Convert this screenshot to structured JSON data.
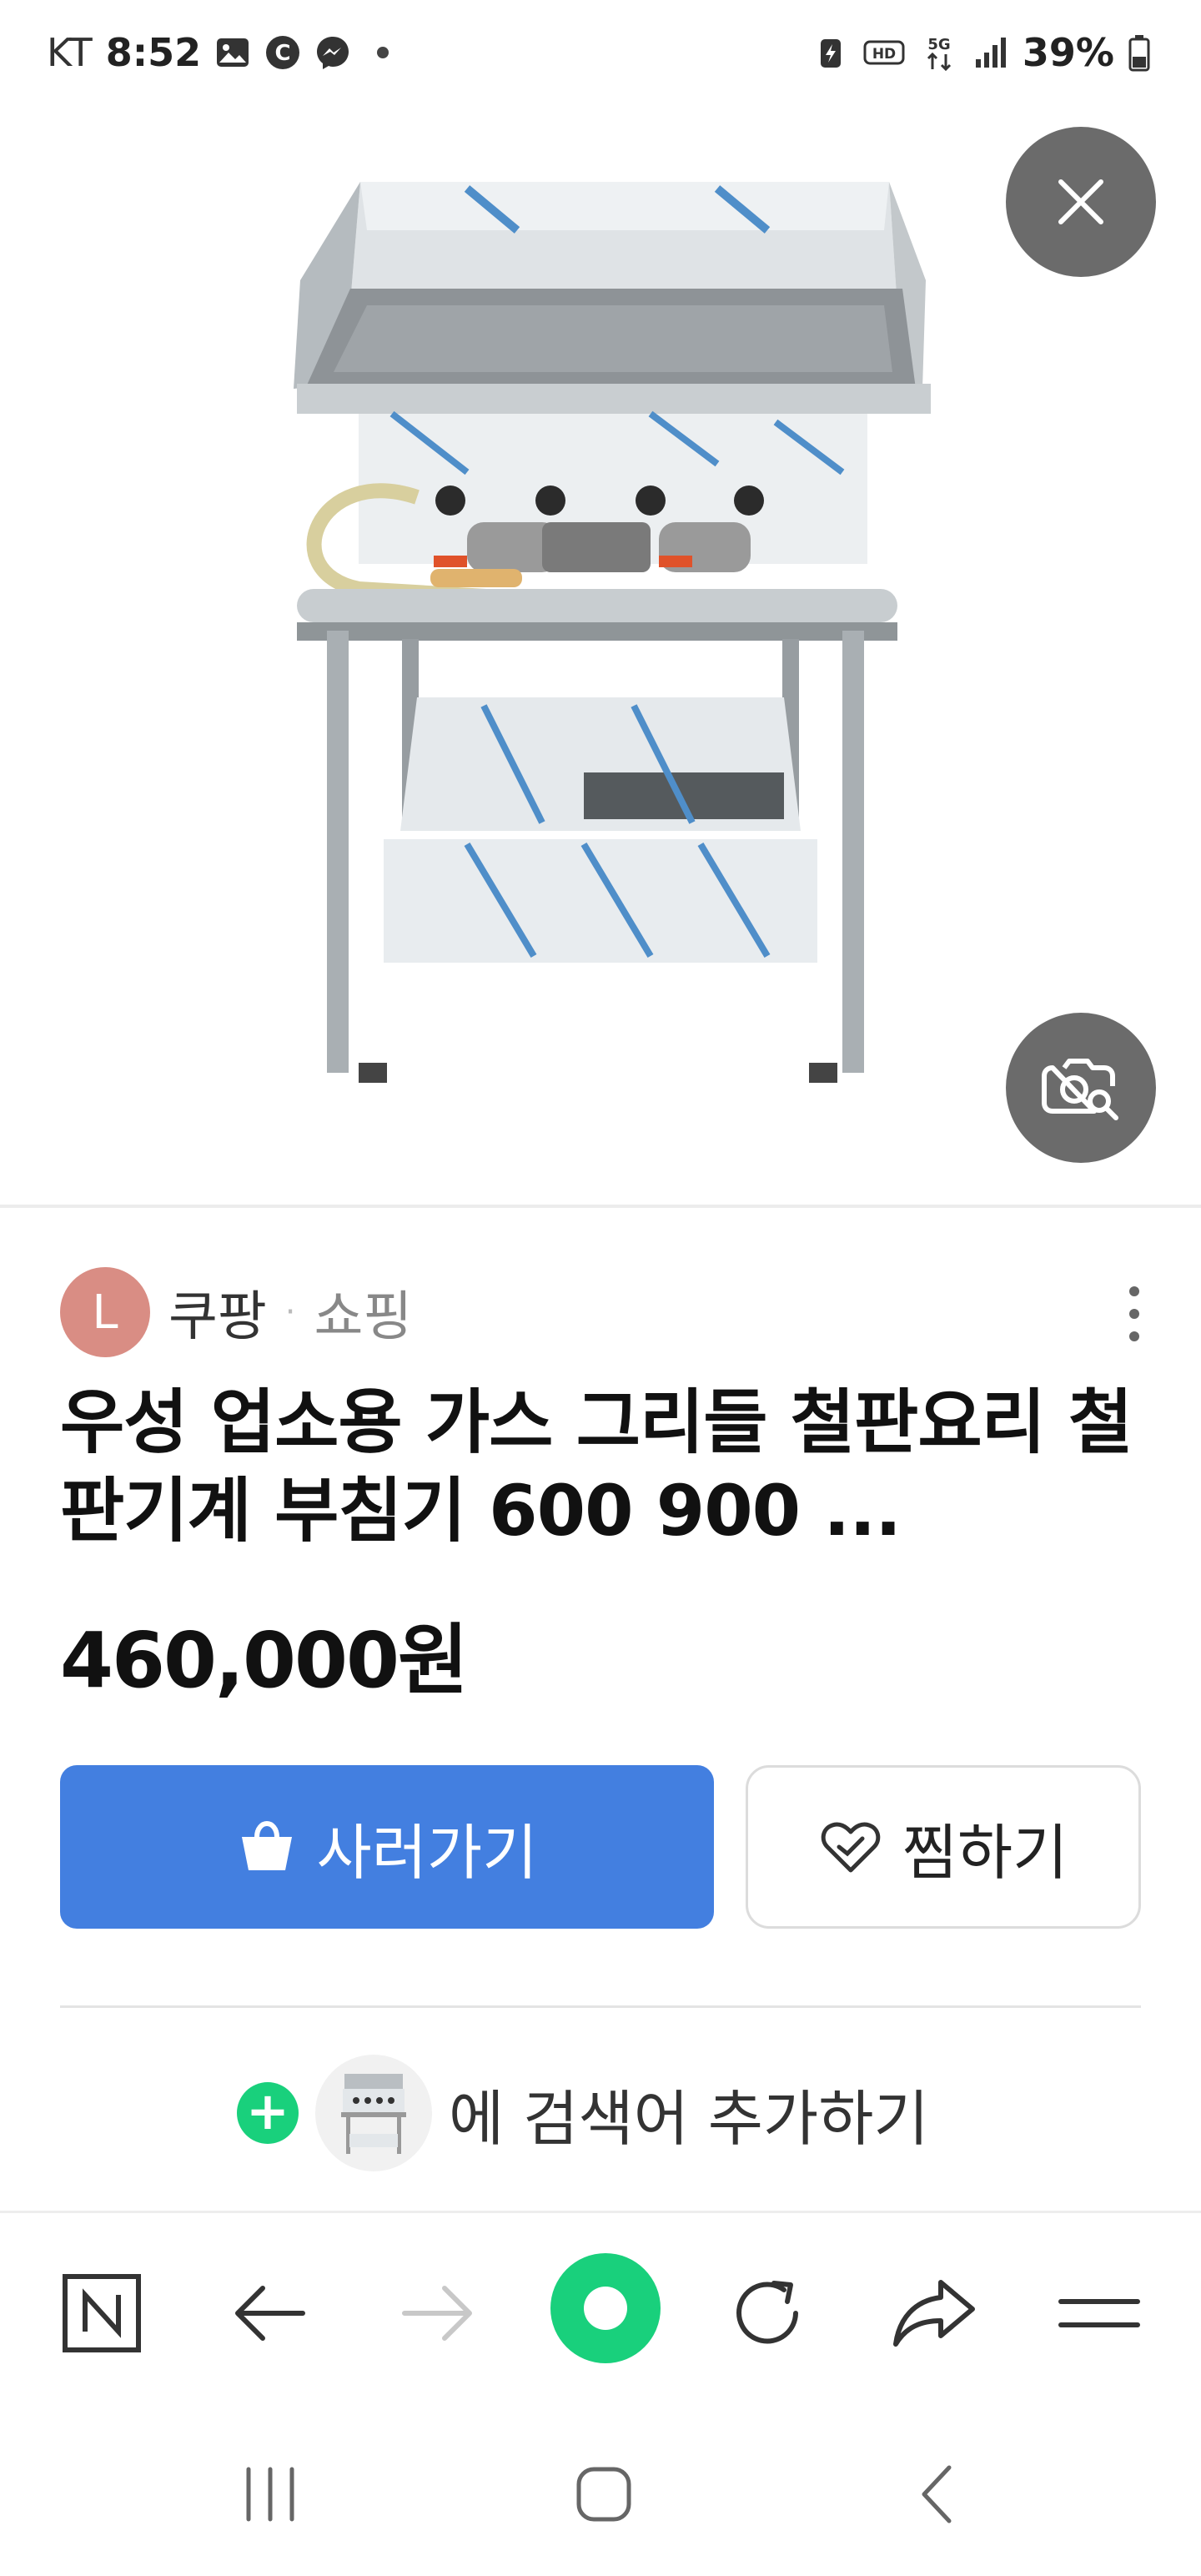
{
  "status_bar": {
    "carrier": "KT",
    "time": "8:52",
    "battery_percent": "39%",
    "network": "5G",
    "left_icons": [
      "gallery-icon",
      "c-badge-icon",
      "messenger-icon",
      "notification-dot-icon"
    ],
    "right_icons": [
      "battery-saver-icon",
      "hd-voice-icon",
      "5g-icon",
      "signal-icon",
      "battery-icon"
    ]
  },
  "image_viewer": {
    "close_icon": "close-icon",
    "lens_icon": "image-search-icon"
  },
  "source": {
    "avatar_letter": "L",
    "name": "쿠팡",
    "separator": "·",
    "category": "쇼핑",
    "avatar_color": "#d98d84"
  },
  "product": {
    "title": "우성 업소용 가스 그리들 철판요리 철판기계 부침기 600 900 ...",
    "price": "460,000원"
  },
  "actions": {
    "buy_label": "사러가기",
    "wish_label": "찜하기",
    "buy_color": "#437fe0"
  },
  "add_keyword": {
    "label": "에 검색어 추가하기",
    "plus_color": "#19d07c"
  },
  "browser_toolbar": {
    "items": [
      "naver-home-icon",
      "back-icon",
      "forward-icon",
      "green-dot-icon",
      "reload-icon",
      "share-icon",
      "menu-icon"
    ]
  },
  "system_nav": {
    "items": [
      "recent-apps-icon",
      "home-icon",
      "back-nav-icon"
    ]
  }
}
